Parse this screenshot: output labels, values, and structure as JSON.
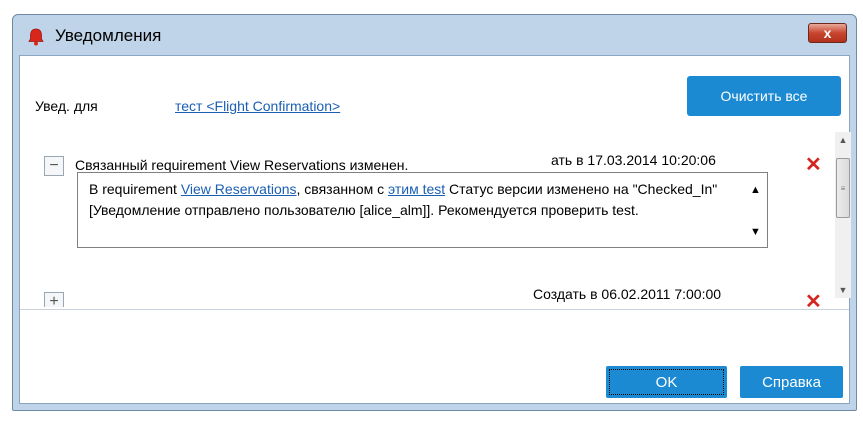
{
  "window": {
    "title": "Уведомления",
    "close_label": "x"
  },
  "header": {
    "for_label": "Увед. для",
    "for_link": "тест <Flight Confirmation>",
    "clear_all": "Очистить все"
  },
  "notifications": [
    {
      "toggle": "−",
      "title": "Связанный requirement View Reservations изменен.",
      "date": "ать в 17.03.2014 10:20:06",
      "delete": "✕",
      "detail": {
        "prefix": "В requirement ",
        "link1": "View Reservations",
        "middle": ", связанном с ",
        "link2": "этим test",
        "suffix": " Статус версии изменено на \"Checked_In\" [Уведомление отправлено пользователю [alice_alm]]. Рекомендуется проверить test."
      }
    },
    {
      "toggle": "+",
      "date": "Создать в 06.02.2011 7:00:00",
      "delete": "✕"
    }
  ],
  "footer": {
    "ok": "OK",
    "help": "Справка"
  },
  "colors": {
    "accent": "#1b8ad3",
    "delete": "#d4261f",
    "link": "#1a5fb4"
  }
}
